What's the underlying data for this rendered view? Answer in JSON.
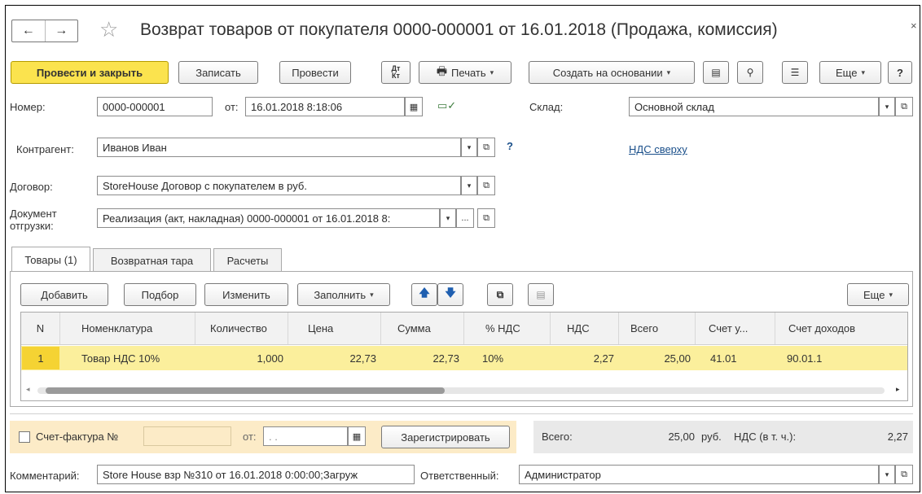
{
  "window": {
    "title": "Возврат товаров от покупателя 0000-000001 от 16.01.2018 (Продажа, комиссия)",
    "back_icon": "←",
    "forward_icon": "→",
    "favorite_icon": "☆",
    "close_icon": "×"
  },
  "toolbar": {
    "post_close": "Провести и закрыть",
    "save": "Записать",
    "post": "Провести",
    "dtkt_icon": "Дт/Кт",
    "print": "Печать",
    "create_based": "Создать на основании",
    "more": "Еще",
    "help": "?"
  },
  "header": {
    "number_label": "Номер:",
    "number_value": "0000-000001",
    "date_label": "от:",
    "date_value": "16.01.2018  8:18:06",
    "warehouse_label": "Склад:",
    "warehouse_value": "Основной склад",
    "counterparty_label": "Контрагент:",
    "counterparty_value": "Иванов Иван",
    "question": "?",
    "vat_link": "НДС сверху",
    "contract_label": "Договор:",
    "contract_value": "StoreHouse Договор с покупателем в руб.",
    "shipment_label_1": "Документ",
    "shipment_label_2": "отгрузки:",
    "shipment_value": "Реализация (акт, накладная) 0000-000001 от 16.01.2018 8:",
    "ellipsis": "..."
  },
  "tabs": [
    {
      "label": "Товары (1)",
      "active": true
    },
    {
      "label": "Возвратная тара",
      "active": false
    },
    {
      "label": "Расчеты",
      "active": false
    }
  ],
  "table_toolbar": {
    "add": "Добавить",
    "pick": "Подбор",
    "change": "Изменить",
    "fill": "Заполнить",
    "more": "Еще"
  },
  "table": {
    "columns": [
      "N",
      "Номенклатура",
      "Количество",
      "Цена",
      "Сумма",
      "% НДС",
      "НДС",
      "Всего",
      "Счет у...",
      "Счет доходов"
    ],
    "rows": [
      [
        "1",
        "Товар НДС 10%",
        "1,000",
        "22,73",
        "22,73",
        "10%",
        "2,27",
        "25,00",
        "41.01",
        "90.01.1"
      ]
    ]
  },
  "invoice": {
    "label": "Счет-фактура №",
    "number_value": "",
    "date_label": "от:",
    "date_value": " .  .",
    "register": "Зарегистрировать"
  },
  "totals": {
    "total_label": "Всего:",
    "total_value": "25,00",
    "currency": "руб.",
    "vat_label": "НДС (в т. ч.):",
    "vat_value": "2,27"
  },
  "footer": {
    "comment_label": "Комментарий:",
    "comment_value": "Store House взр №310 от 16.01.2018 0:00:00;Загруж",
    "responsible_label": "Ответственный:",
    "responsible_value": "Администратор"
  },
  "colors": {
    "primary_button": "#fbe34e",
    "selected_row": "#fbef9c",
    "link": "#1a4f8a",
    "invoice_block": "#fcebc7"
  }
}
